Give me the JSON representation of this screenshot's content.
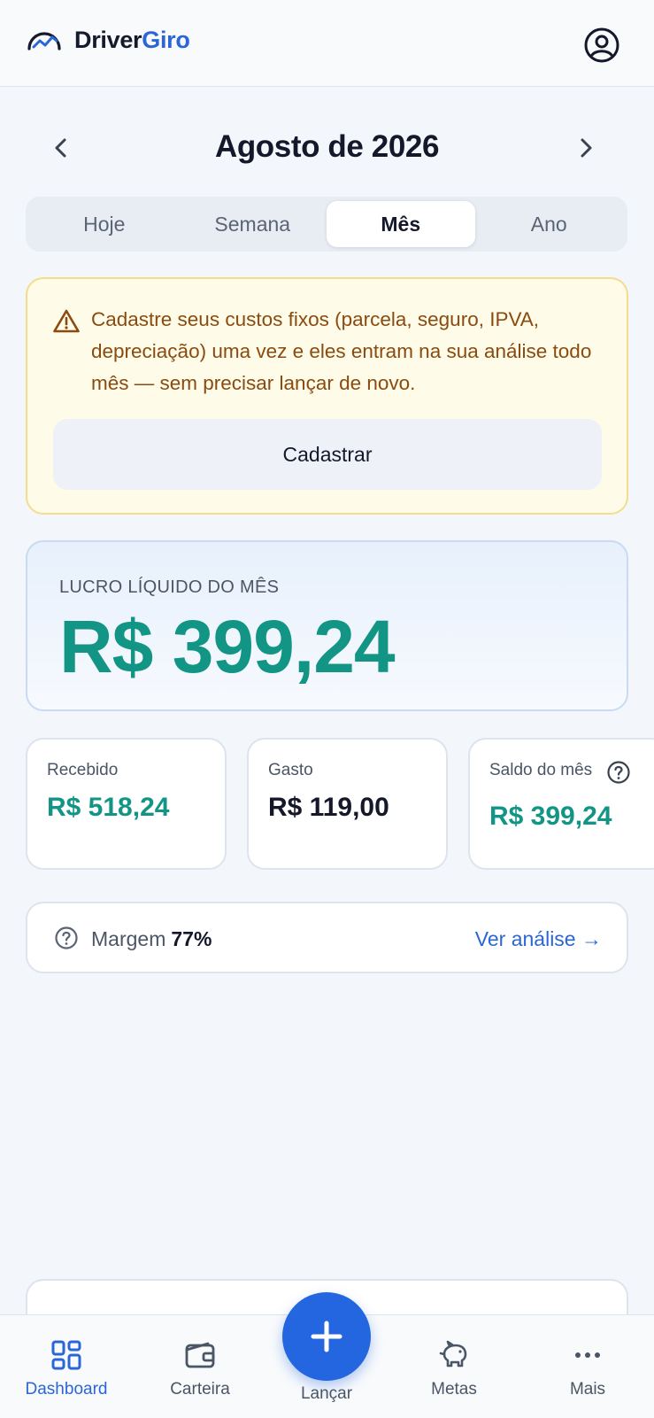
{
  "header": {
    "brand_part1": "Driver",
    "brand_part2": "Giro",
    "brand_icon": "speedometer-chart-icon",
    "profile_icon": "user-circle-icon"
  },
  "period": {
    "title": "Agosto de 2026",
    "prev_icon": "chevron-left-icon",
    "next_icon": "chevron-right-icon",
    "tabs": [
      {
        "label": "Hoje",
        "active": false
      },
      {
        "label": "Semana",
        "active": false
      },
      {
        "label": "Mês",
        "active": true
      },
      {
        "label": "Ano",
        "active": false
      }
    ]
  },
  "warning": {
    "icon": "warning-triangle-icon",
    "text": "Cadastre seus custos fixos (parcela, seguro, IPVA, depreciação) uma vez e eles entram na sua análise todo mês — sem precisar lançar de novo.",
    "button_label": "Cadastrar"
  },
  "profit": {
    "label": "LUCRO LÍQUIDO DO MÊS",
    "value": "R$ 399,24"
  },
  "stats": {
    "received": {
      "label": "Recebido",
      "value": "R$ 518,24"
    },
    "spent": {
      "label": "Gasto",
      "value": "R$ 119,00"
    },
    "balance": {
      "label": "Saldo do mês",
      "value": "R$ 399,24",
      "help_icon": "help-circle-icon"
    }
  },
  "margin": {
    "label": "Margem",
    "value": "77%",
    "link": "Ver análise →",
    "help_icon": "help-circle-icon"
  },
  "bottom_nav": {
    "items": [
      {
        "label": "Dashboard",
        "icon": "grid-icon",
        "active": true
      },
      {
        "label": "Carteira",
        "icon": "wallet-icon",
        "active": false
      },
      {
        "label": "Lançar",
        "icon": "plus-icon",
        "active": false
      },
      {
        "label": "Metas",
        "icon": "piggy-bank-icon",
        "active": false
      },
      {
        "label": "Mais",
        "icon": "more-dots-icon",
        "active": false
      }
    ]
  },
  "colors": {
    "accent_blue": "#2a66d6",
    "profit_green": "#129584",
    "warning_text": "#8a4b10",
    "warning_bg": "#fefbe9"
  }
}
